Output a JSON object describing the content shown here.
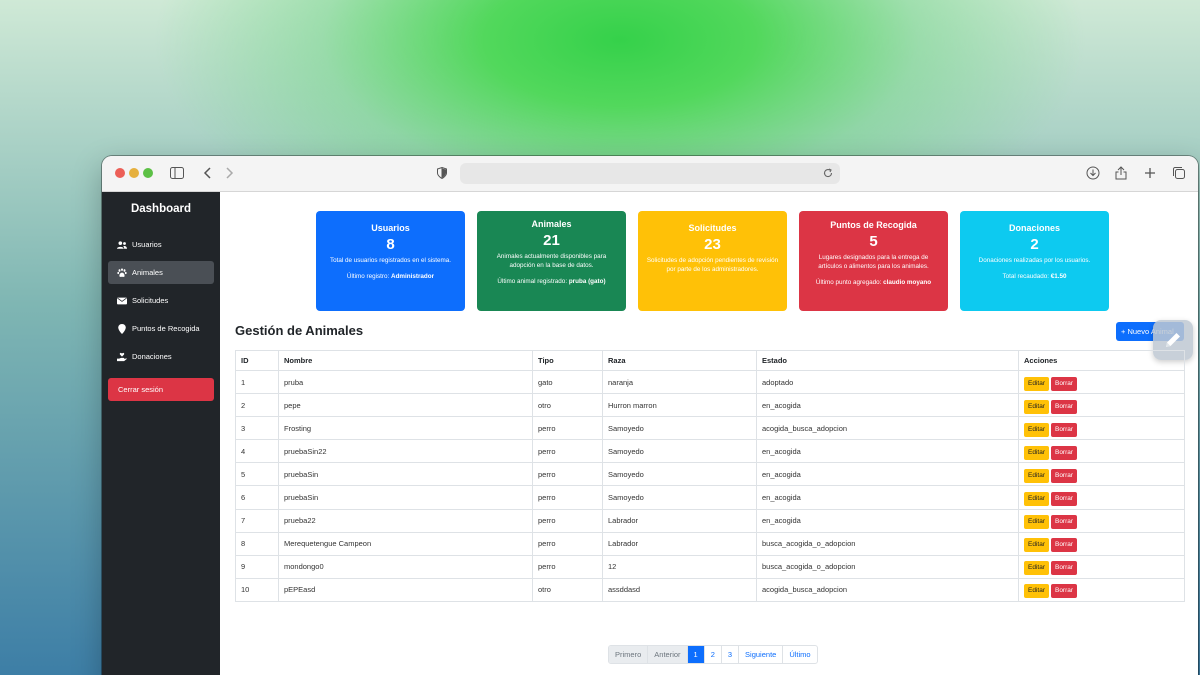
{
  "sidebar": {
    "title": "Dashboard",
    "items": [
      {
        "label": "Usuarios",
        "icon": "users-icon"
      },
      {
        "label": "Animales",
        "icon": "paw-icon"
      },
      {
        "label": "Solicitudes",
        "icon": "envelope-icon"
      },
      {
        "label": "Puntos de Recogida",
        "icon": "map-pin-icon"
      },
      {
        "label": "Donaciones",
        "icon": "hand-holding-heart-icon"
      }
    ],
    "active": "Animales",
    "logout": "Cerrar sesión"
  },
  "cards": [
    {
      "title": "Usuarios",
      "number": "8",
      "desc": "Total de usuarios registrados en el sistema.",
      "footer_label": "Último registro:",
      "footer_value": "Administrador",
      "color": "#0d6efd"
    },
    {
      "title": "Animales",
      "number": "21",
      "desc": "Animales actualmente disponibles para adopción en la base de datos.",
      "footer_label": "Último animal registrado:",
      "footer_value": "pruba (gato)",
      "color": "#198754"
    },
    {
      "title": "Solicitudes",
      "number": "23",
      "desc": "Solicitudes de adopción pendientes de revisión por parte de los administradores.",
      "footer_label": "",
      "footer_value": "",
      "color": "#ffc107"
    },
    {
      "title": "Puntos de Recogida",
      "number": "5",
      "desc": "Lugares designados para la entrega de artículos o alimentos para los animales.",
      "footer_label": "Último punto agregado:",
      "footer_value": "claudio moyano",
      "color": "#dc3545"
    },
    {
      "title": "Donaciones",
      "number": "2",
      "desc": "Donaciones realizadas por los usuarios.",
      "footer_label": "Total recaudado:",
      "footer_value": "€1.50",
      "color": "#0dcaf0"
    }
  ],
  "section": {
    "title": "Gestión de Animales",
    "new_button": "+ Nuevo Animal"
  },
  "table": {
    "headers": [
      "ID",
      "Nombre",
      "Tipo",
      "Raza",
      "Estado",
      "Acciones"
    ],
    "rows": [
      [
        "1",
        "pruba",
        "gato",
        "naranja",
        "adoptado"
      ],
      [
        "2",
        "pepe",
        "otro",
        "Hurron marron",
        "en_acogida"
      ],
      [
        "3",
        "Frosting",
        "perro",
        "Samoyedo",
        "acogida_busca_adopcion"
      ],
      [
        "4",
        "pruebaSin22",
        "perro",
        "Samoyedo",
        "en_acogida"
      ],
      [
        "5",
        "pruebaSin",
        "perro",
        "Samoyedo",
        "en_acogida"
      ],
      [
        "6",
        "pruebaSin",
        "perro",
        "Samoyedo",
        "en_acogida"
      ],
      [
        "7",
        "prueba22",
        "perro",
        "Labrador",
        "en_acogida"
      ],
      [
        "8",
        "Merequetengue Campeon",
        "perro",
        "Labrador",
        "busca_acogida_o_adopcion"
      ],
      [
        "9",
        "mondongo0",
        "perro",
        "12",
        "busca_acogida_o_adopcion"
      ],
      [
        "10",
        "pEPEasd",
        "otro",
        "assddasd",
        "acogida_busca_adopcion"
      ]
    ],
    "edit_label": "Editar",
    "delete_label": "Borrar"
  },
  "pagination": {
    "first": "Primero",
    "prev": "Anterior",
    "pages": [
      "1",
      "2",
      "3"
    ],
    "current": "1",
    "next": "Siguiente",
    "last": "Último"
  }
}
